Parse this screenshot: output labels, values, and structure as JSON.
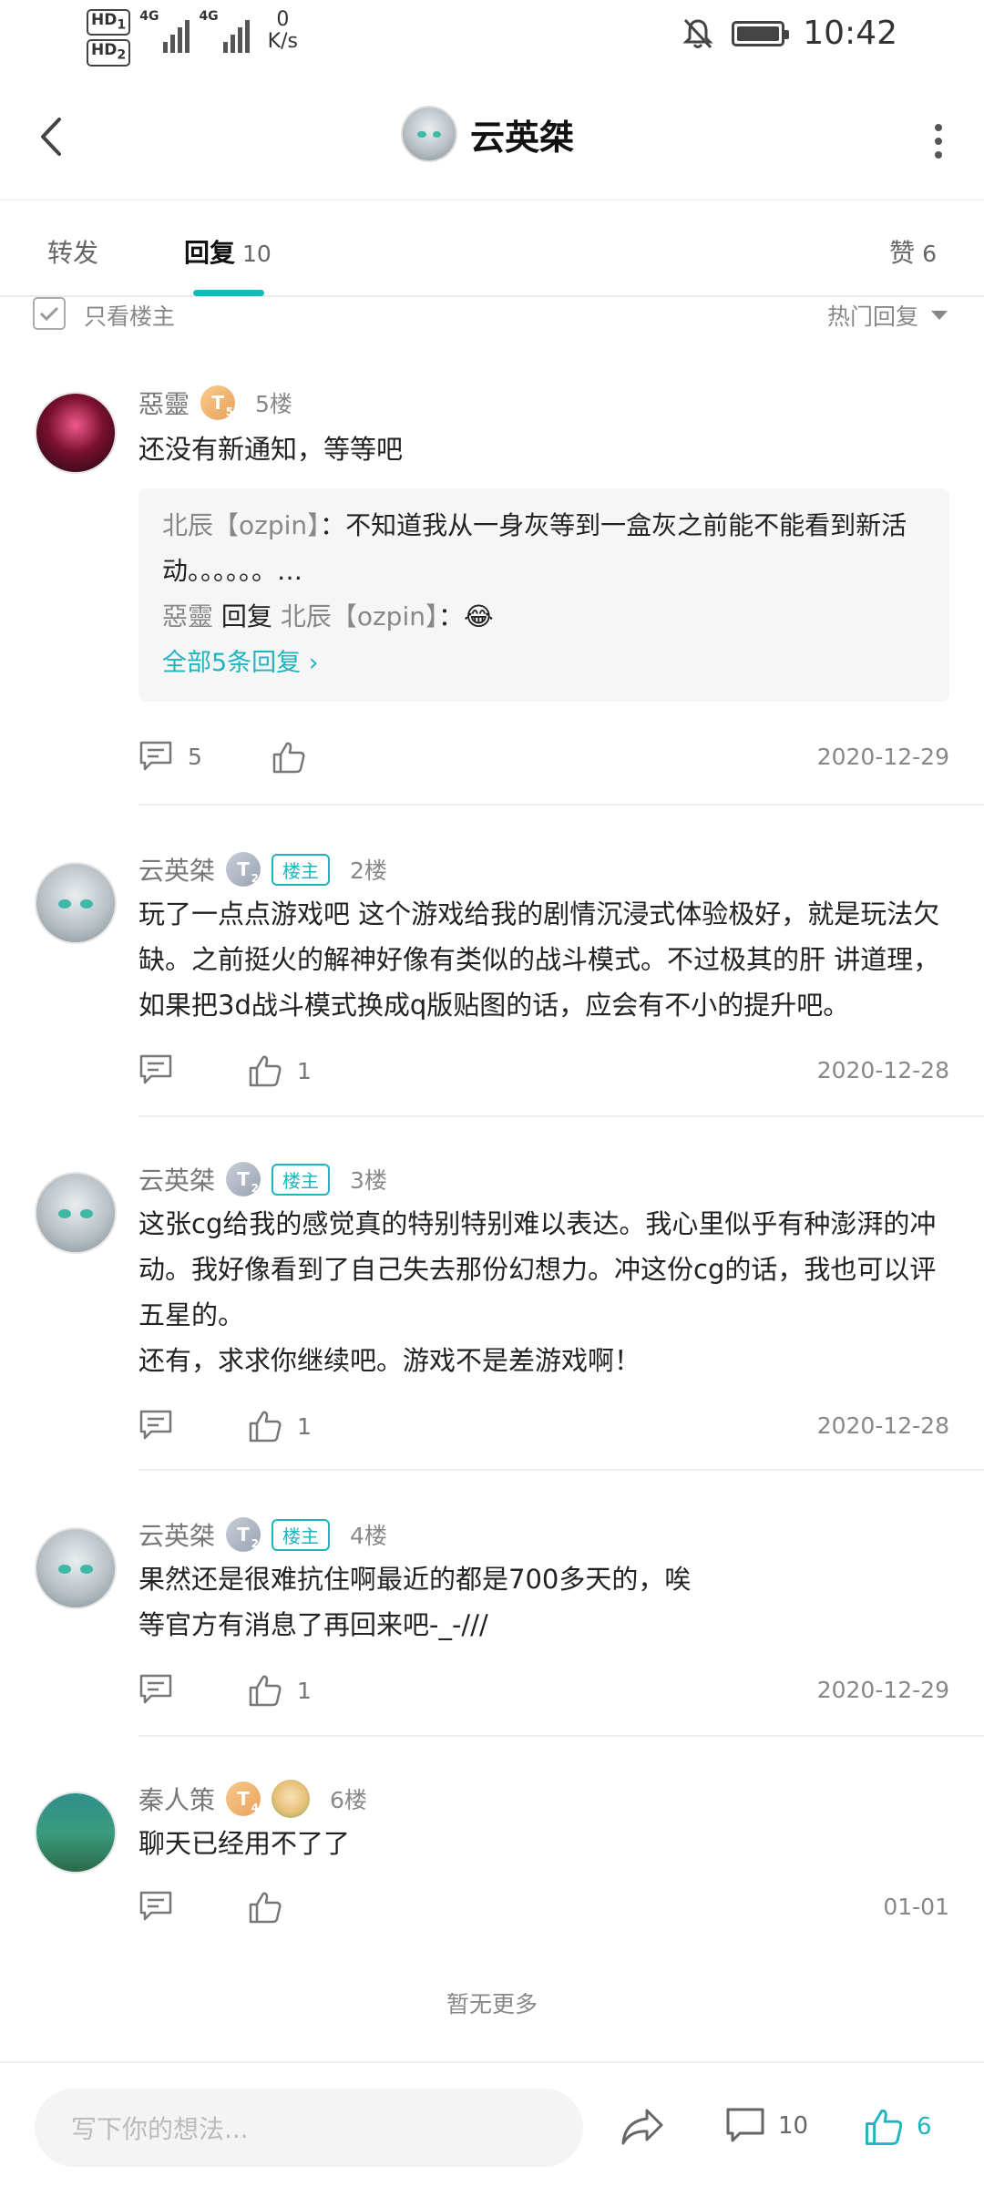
{
  "status_bar": {
    "hd1": "HD",
    "hd1_sub": "1",
    "hd2": "HD",
    "hd2_sub": "2",
    "signal1": "4G",
    "signal2": "4G",
    "net_speed": "0",
    "net_unit": "K/s",
    "time": "10:42",
    "icons": [
      "mute-bell-icon",
      "battery-icon"
    ]
  },
  "header": {
    "title": "云英桀",
    "back_icon": "chevron-left-icon",
    "more_icon": "more-vertical-icon"
  },
  "tabs": {
    "forward": "转发",
    "reply": "回复",
    "reply_count": "10",
    "like": "赞",
    "like_count": "6",
    "active": "回复",
    "accent": "#1fb5bf"
  },
  "filter": {
    "only_op": "只看楼主",
    "sort": "热门回复"
  },
  "posts": [
    {
      "user": "惡靈",
      "level": "T",
      "level_sub": "5",
      "floor": "5楼",
      "content": "还没有新通知，等等吧",
      "quote": {
        "line1_user": "北辰【ozpin】",
        "line1_text": "：不知道我从一身灰等到一盒灰之前能不能看到新活动。。。。。。…",
        "line2_user": "惡靈",
        "line2_reply": "回复",
        "line2_target": "北辰【ozpin】",
        "line2_text": "：😂",
        "more": "全部5条回复"
      },
      "comments": "5",
      "likes": "",
      "date": "2020-12-29"
    },
    {
      "user": "云英桀",
      "level": "T",
      "level_sub": "2",
      "badge": "楼主",
      "floor": "2楼",
      "content": "玩了一点点游戏吧 这个游戏给我的剧情沉浸式体验极好，就是玩法欠缺。之前挺火的解神好像有类似的战斗模式。不过极其的肝 讲道理， 如果把3d战斗模式换成q版贴图的话，应会有不小的提升吧。",
      "comments": "",
      "likes": "1",
      "date": "2020-12-28"
    },
    {
      "user": "云英桀",
      "level": "T",
      "level_sub": "2",
      "badge": "楼主",
      "floor": "3楼",
      "content_line1": "这张cg给我的感觉真的特别特别难以表达。我心里似乎有种澎湃的冲动。我好像看到了自己失去那份幻想力。冲这份cg的话，我也可以评五星的。",
      "content_line2": "还有，求求你继续吧。游戏不是差游戏啊！",
      "comments": "",
      "likes": "1",
      "date": "2020-12-28"
    },
    {
      "user": "云英桀",
      "level": "T",
      "level_sub": "2",
      "badge": "楼主",
      "floor": "4楼",
      "content_line1": "果然还是很难抗住啊最近的都是700多天的，唉",
      "content_line2": "等官方有消息了再回来吧-_-///",
      "comments": "",
      "likes": "1",
      "date": "2020-12-29"
    },
    {
      "user": "秦人策",
      "level": "T",
      "level_sub": "4",
      "floor": "6楼",
      "content": "聊天已经用不了了",
      "comments": "",
      "likes": "",
      "date": "01-01"
    }
  ],
  "no_more": "暂无更多",
  "bottom_bar": {
    "placeholder": "写下你的想法...",
    "comment_count": "10",
    "like_count": "6",
    "accent": "#1fb5bf"
  }
}
